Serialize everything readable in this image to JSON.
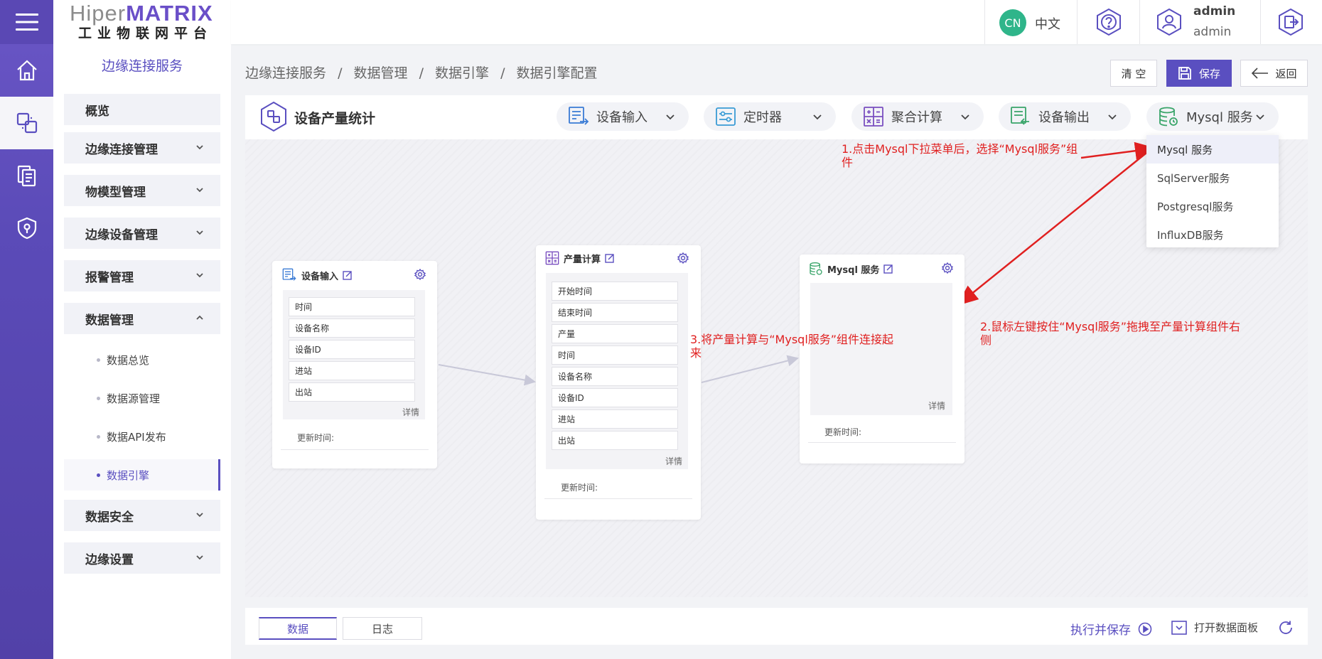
{
  "brand": {
    "logo_part1": "Hiper",
    "logo_part2": "MATRIX",
    "subtitle": "工业物联网平台"
  },
  "sidebar": {
    "title": "边缘连接服务",
    "menus": [
      {
        "label": "概览"
      },
      {
        "label": "边缘连接管理"
      },
      {
        "label": "物模型管理"
      },
      {
        "label": "边缘设备管理"
      },
      {
        "label": "报警管理"
      },
      {
        "label": "数据管理"
      },
      {
        "label": "数据安全"
      },
      {
        "label": "边缘设置"
      }
    ],
    "data_sub": [
      {
        "label": "数据总览"
      },
      {
        "label": "数据源管理"
      },
      {
        "label": "数据API发布"
      },
      {
        "label": "数据引擎"
      }
    ]
  },
  "header": {
    "lang_badge": "CN",
    "lang_label": "中文",
    "user_name": "admin",
    "user_role": "admin"
  },
  "breadcrumb": [
    "边缘连接服务",
    "数据管理",
    "数据引擎",
    "数据引擎配置"
  ],
  "breadcrumb_sep": "/",
  "actions": {
    "clear": "清 空",
    "save": "保存",
    "back": "返回"
  },
  "flow": {
    "title": "设备产量统计"
  },
  "tools": [
    {
      "label": "设备输入"
    },
    {
      "label": "定时器"
    },
    {
      "label": "聚合计算"
    },
    {
      "label": "设备输出"
    },
    {
      "label": "Mysql 服务"
    }
  ],
  "dropdown": [
    "Mysql 服务",
    "SqlServer服务",
    "Postgresql服务",
    "InfluxDB服务"
  ],
  "nodes": {
    "input": {
      "title": "设备输入",
      "fields": [
        "时间",
        "设备名称",
        "设备ID",
        "进站",
        "出站"
      ],
      "detail": "详情",
      "updated": "更新时间:"
    },
    "calc": {
      "title": "产量计算",
      "fields": [
        "开始时间",
        "结束时间",
        "产量",
        "时间",
        "设备名称",
        "设备ID",
        "进站",
        "出站"
      ],
      "detail": "详情",
      "updated": "更新时间:"
    },
    "mysql": {
      "title": "Mysql 服务",
      "detail": "详情",
      "updated": "更新时间:"
    }
  },
  "annotations": {
    "step1_line1": "1.点击Mysql下拉菜单后，选择“Mysql服务”组",
    "step1_line2": "件",
    "step2_line1": "2.鼠标左键按住“Mysql服务”拖拽至产量计算组件右",
    "step2_line2": "侧",
    "step3_line1": "3.将产量计算与“Mysql服务”组件连接起",
    "step3_line2": "来"
  },
  "bottom": {
    "tab_data": "数据",
    "tab_log": "日志",
    "run_save": "执行并保存",
    "open_panel": "打开数据面板"
  },
  "colors": {
    "accent": "#5a4fc0",
    "annotation": "#e02020",
    "badge": "#2fb58a"
  }
}
